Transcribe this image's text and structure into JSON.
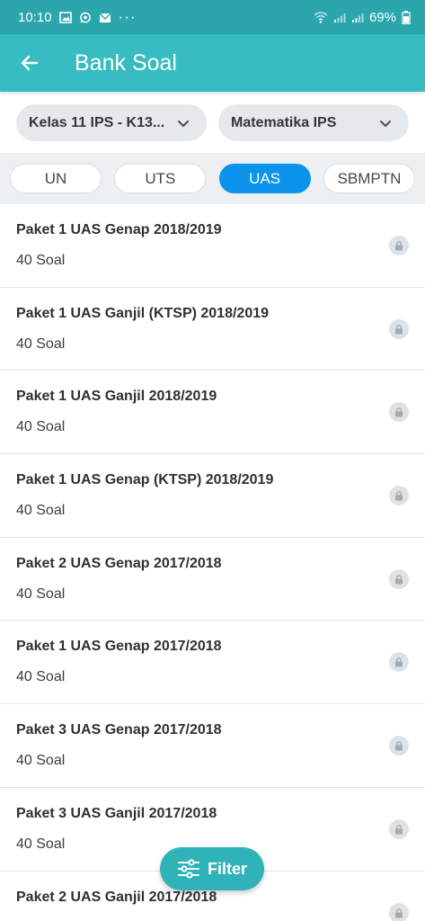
{
  "status_bar": {
    "time": "10:10",
    "battery": "69%",
    "dots": "···"
  },
  "app_bar": {
    "title": "Bank Soal"
  },
  "filters": {
    "class": "Kelas 11 IPS - K13...",
    "subject": "Matematika IPS"
  },
  "tabs": [
    {
      "label": "UN",
      "active": false
    },
    {
      "label": "UTS",
      "active": false
    },
    {
      "label": "UAS",
      "active": true
    },
    {
      "label": "SBMPTN",
      "active": false
    }
  ],
  "packages": [
    {
      "title": "Paket 1 UAS Genap 2018/2019",
      "count": "40 Soal"
    },
    {
      "title": "Paket 1 UAS Ganjil (KTSP) 2018/2019",
      "count": "40 Soal"
    },
    {
      "title": "Paket 1 UAS Ganjil 2018/2019",
      "count": "40 Soal"
    },
    {
      "title": "Paket 1 UAS Genap (KTSP) 2018/2019",
      "count": "40 Soal"
    },
    {
      "title": "Paket 2 UAS Genap 2017/2018",
      "count": "40 Soal"
    },
    {
      "title": "Paket 1 UAS Genap 2017/2018",
      "count": "40 Soal"
    },
    {
      "title": "Paket 3 UAS Genap 2017/2018",
      "count": "40 Soal"
    },
    {
      "title": "Paket 3 UAS Ganjil 2017/2018",
      "count": "40 Soal"
    },
    {
      "title": "Paket 2 UAS Ganjil 2017/2018",
      "count": ""
    }
  ],
  "fab": {
    "label": "Filter"
  },
  "colors": {
    "primary": "#36bcc1",
    "status_bar": "#2aa6ac",
    "tab_active": "#0c94ec"
  }
}
